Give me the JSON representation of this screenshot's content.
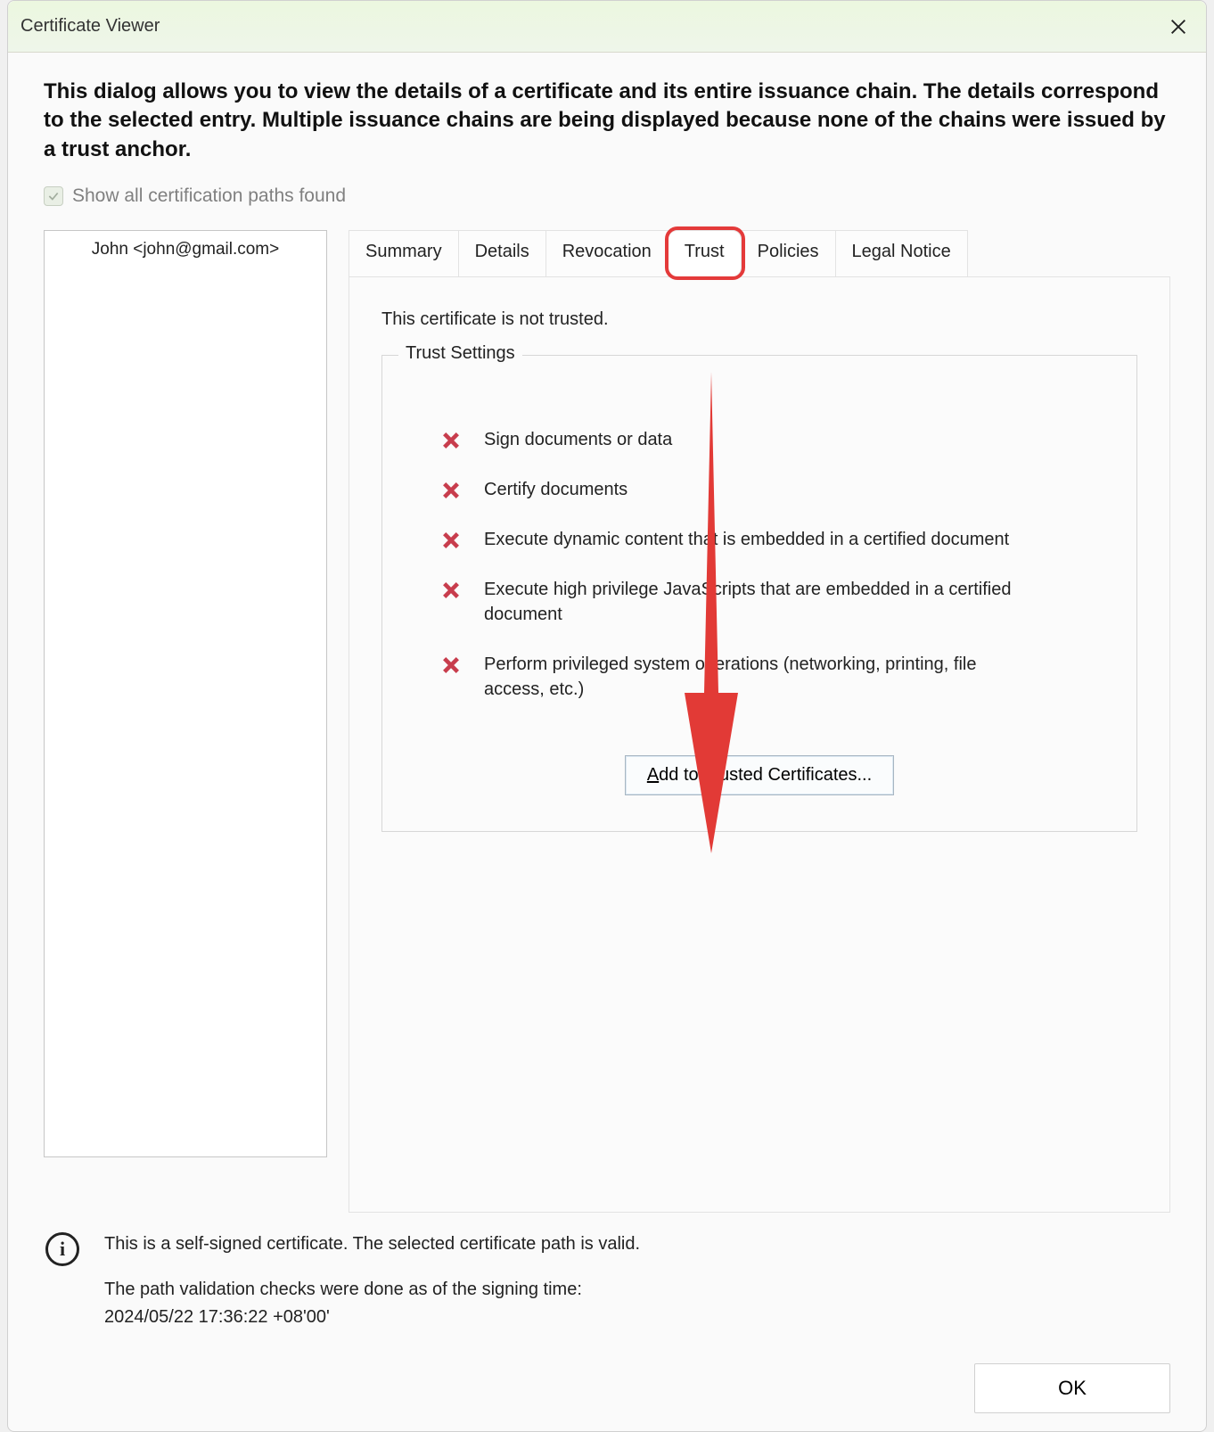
{
  "titlebar": {
    "title": "Certificate Viewer"
  },
  "intro": "This dialog allows you to view the details of a certificate and its entire issuance chain. The details correspond to the selected entry. Multiple issuance chains are being displayed because none of the chains were issued by a trust anchor.",
  "show_all_paths_label": "Show all certification paths found",
  "cert_list": {
    "items": [
      "John <john@gmail.com>"
    ]
  },
  "tabs": {
    "items": [
      "Summary",
      "Details",
      "Revocation",
      "Trust",
      "Policies",
      "Legal Notice"
    ],
    "active_index": 3
  },
  "trust_panel": {
    "status": "This certificate is not trusted.",
    "legend": "Trust Settings",
    "permissions": [
      "Sign documents or data",
      "Certify documents",
      "Execute dynamic content that is embedded in a certified document",
      "Execute high privilege JavaScripts that are embedded in a certified document",
      "Perform privileged system operations (networking, printing, file access, etc.)"
    ],
    "add_button_prefix": "A",
    "add_button_rest": "dd to Trusted Certificates..."
  },
  "footer": {
    "line1": "This is a self-signed certificate. The selected certificate path is valid.",
    "line2": "The path validation checks were done as of the signing time:",
    "line3": "2024/05/22 17:36:22 +08'00'"
  },
  "ok_label": "OK",
  "annotation": {
    "highlight_color": "#e43a3a",
    "arrow_color": "#e23a36"
  }
}
